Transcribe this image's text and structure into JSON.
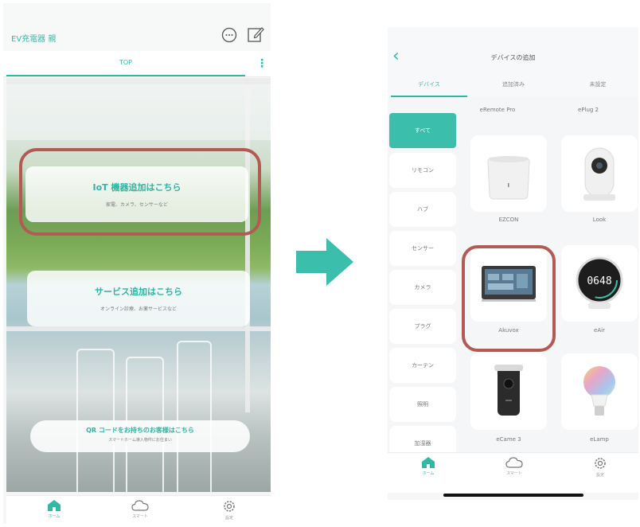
{
  "left_screen": {
    "header_title": "EV充電器 親",
    "icons": {
      "chat": "chat-bubble-icon",
      "edit": "edit-icon",
      "more": "more-vertical-icon"
    },
    "tab_label": "TOP",
    "card_iot": {
      "title": "IoT 機器追加はこちら",
      "subtitle": "家電、カメラ、センサーなど"
    },
    "card_service": {
      "title": "サービス追加はこちら",
      "subtitle": "オンライン診療、お薬サービスなど"
    },
    "qr_banner": {
      "title": "QR コードをお持ちのお客様はこちら",
      "subtitle": "スマートホーム導入物件にお住まい"
    },
    "bottom_nav": [
      {
        "label": "ホーム",
        "icon": "home-icon",
        "active": true
      },
      {
        "label": "スマート",
        "icon": "cloud-icon",
        "active": false
      },
      {
        "label": "設定",
        "icon": "gear-icon",
        "active": false
      }
    ]
  },
  "right_screen": {
    "title": "デバイスの追加",
    "back_icon": "chevron-left-icon",
    "tabs": [
      "デバイス",
      "追加済み",
      "未設定"
    ],
    "categories": [
      "すべて",
      "リモコン",
      "ハブ",
      "センサー",
      "カメラ",
      "プラグ",
      "カーテン",
      "照明",
      "加湿器"
    ],
    "top_labels": [
      "eRemote Pro",
      "ePlug 2"
    ],
    "devices": [
      {
        "name": "EZCON",
        "icon": "remote-hub-icon"
      },
      {
        "name": "Look",
        "icon": "camera-icon"
      },
      {
        "name": "Akuvox",
        "icon": "intercom-panel-icon"
      },
      {
        "name": "eAir",
        "icon": "air-sensor-icon",
        "display": "0648"
      },
      {
        "name": "eCame 3",
        "icon": "battery-camera-icon"
      },
      {
        "name": "eLamp",
        "icon": "bulb-icon"
      }
    ],
    "bottom_nav": [
      {
        "label": "ホーム",
        "icon": "home-icon",
        "active": true
      },
      {
        "label": "スマート",
        "icon": "cloud-icon",
        "active": false
      },
      {
        "label": "設定",
        "icon": "gear-icon",
        "active": false
      }
    ]
  },
  "colors": {
    "accent": "#32b8a6",
    "highlight": "#b45a55",
    "arrow": "#3bbfac"
  }
}
